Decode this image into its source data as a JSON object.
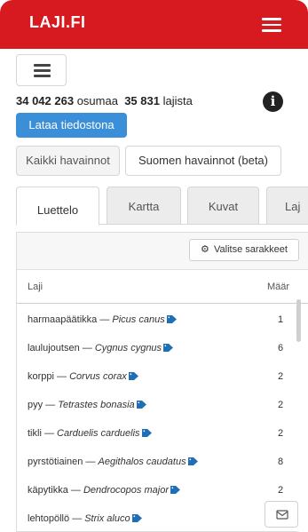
{
  "header": {
    "logo": "LAJI.FI",
    "menu_icon": "hamburger-menu-icon"
  },
  "toolbar": {
    "menu_icon": "hamburger-menu-icon"
  },
  "summary": {
    "observations_count": "34 042 263",
    "observations_label": "osumaa",
    "species_count": "35 831",
    "species_label": "lajista",
    "info_icon": "info-circle-icon"
  },
  "download_label": "Lataa tiedostona",
  "filters": [
    {
      "label": "Kaikki havainnot",
      "active": false
    },
    {
      "label": "Suomen havainnot (beta)",
      "active": true
    }
  ],
  "tabs": [
    {
      "label": "Luettelo",
      "active": true
    },
    {
      "label": "Kartta",
      "active": false
    },
    {
      "label": "Kuvat",
      "active": false
    },
    {
      "label": "Laj",
      "active": false
    }
  ],
  "table": {
    "select_columns_label": "Valitse sarakkeet",
    "select_columns_icon": "gear-icon",
    "headers": {
      "species": "Laji",
      "count": "Määr"
    },
    "rows": [
      {
        "common": "harmaapäätikka",
        "sep": " — ",
        "scientific": "Picus canus",
        "count": "1"
      },
      {
        "common": "laulujoutsen",
        "sep": " — ",
        "scientific": "Cygnus cygnus",
        "count": "6"
      },
      {
        "common": "korppi",
        "sep": " — ",
        "scientific": "Corvus corax",
        "count": "2"
      },
      {
        "common": "pyy",
        "sep": " — ",
        "scientific": "Tetrastes bonasia",
        "count": "2"
      },
      {
        "common": "tikli",
        "sep": " — ",
        "scientific": "Carduelis carduelis",
        "count": "2"
      },
      {
        "common": "pyrstötiainen",
        "sep": " — ",
        "scientific": "Aegithalos caudatus",
        "count": "8"
      },
      {
        "common": "käpytikka",
        "sep": " — ",
        "scientific": "Dendrocopos major",
        "count": "2"
      },
      {
        "common": "lehtopöllö",
        "sep": " — ",
        "scientific": "Strix aluco",
        "count": ""
      }
    ],
    "tag_icon": "tag-icon",
    "tag_color": "#1f6fb5"
  },
  "feedback_icon": "envelope-icon",
  "colors": {
    "brand_red": "#d71920",
    "primary_blue": "#3a8fd8"
  }
}
